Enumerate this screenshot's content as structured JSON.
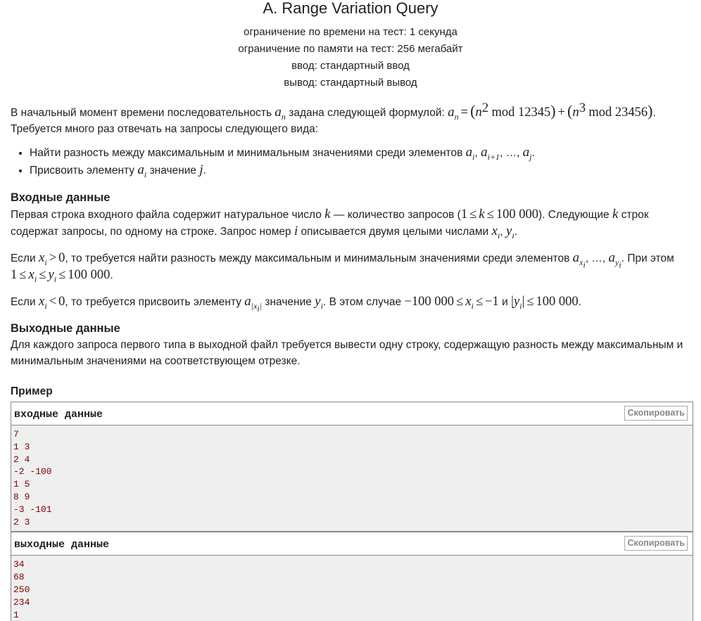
{
  "problem": {
    "title": "A. Range Variation Query",
    "time_limit": "ограничение по времени на тест: 1 секунда",
    "memory_limit": "ограничение по памяти на тест: 256 мегабайт",
    "input_file": "ввод: стандартный ввод",
    "output_file": "вывод: стандартный вывод"
  },
  "statement": {
    "p1_a": "В начальный момент времени последовательность",
    "p1_b": "задана следующей формулой:",
    "p1_c": "Требуется много раз отвечать на запросы следующего вида:",
    "bullet1": "Найти разность между максимальным и минимальным значениями среди элементов",
    "bullet2_a": "Присвоить элементу",
    "bullet2_b": "значение"
  },
  "input_section": {
    "heading": "Входные данные",
    "p1_a": "Первая строка входного файла содержит натуральное число",
    "p1_b": "— количество запросов (",
    "p1_c": "). Следующие",
    "p1_d": "строк содержат запросы, по одному на строке. Запрос номер",
    "p1_e": "описывается двумя целыми числами",
    "p2_a": "Если",
    "p2_b": ", то требуется найти разность между максимальным и минимальным значениями среди элементов",
    "p2_c": ". При этом",
    "p3_a": "Если",
    "p3_b": ", то требуется присвоить элементу",
    "p3_c": "значение",
    "p3_d": ". В этом случае",
    "p3_e": "и"
  },
  "output_section": {
    "heading": "Выходные данные",
    "text": "Для каждого запроса первого типа в выходной файл требуется вывести одну строку, содержащую разность между максимальным и минимальным значениями на соответствующем отрезке."
  },
  "example": {
    "heading": "Пример",
    "input_title": "входные данные",
    "output_title": "выходные данные",
    "copy_label": "Скопировать",
    "input_lines": [
      "7",
      "1 3",
      "2 4",
      "-2 -100",
      "1 5",
      "8 9",
      "-3 -101",
      "2 3"
    ],
    "output_lines": [
      "34",
      "68",
      "250",
      "234",
      "1"
    ]
  }
}
